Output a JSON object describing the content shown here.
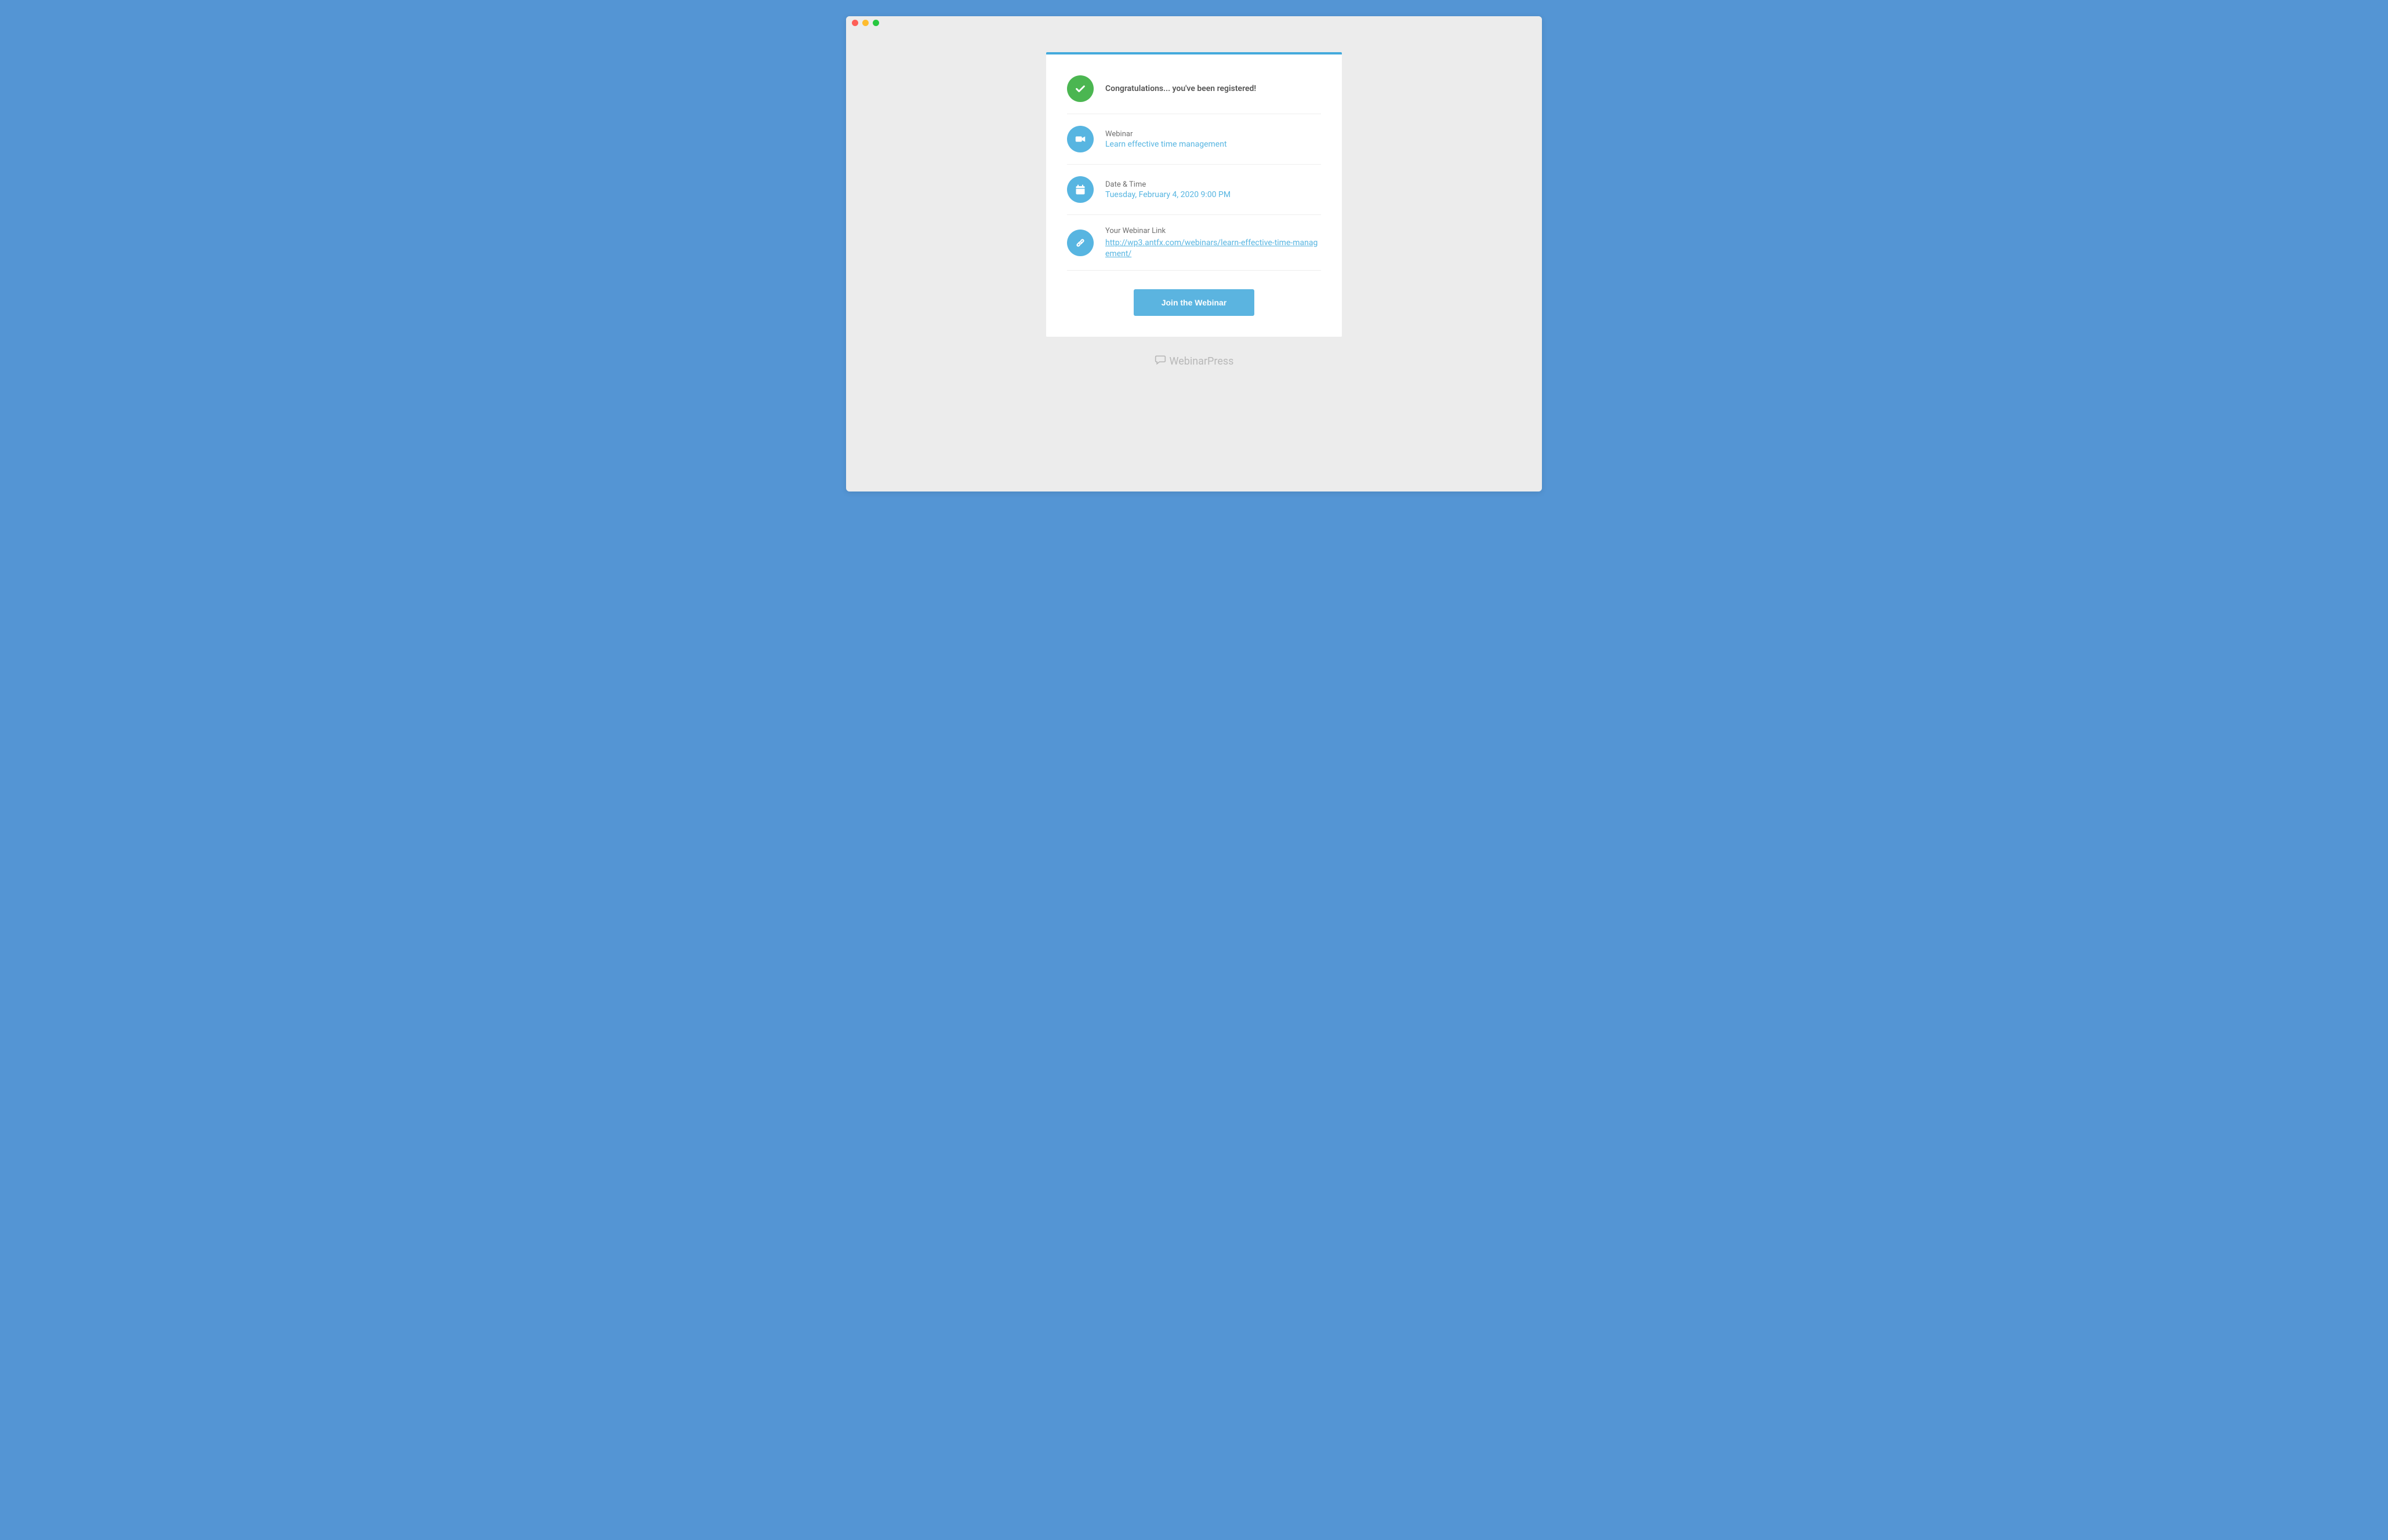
{
  "headline": "Congratulations... you've been registered!",
  "webinar": {
    "label": "Webinar",
    "value": "Learn effective time management"
  },
  "datetime": {
    "label": "Date & Time",
    "value": "Tuesday, February 4, 2020 9:00 PM"
  },
  "link": {
    "label": "Your Webinar Link",
    "value": "http://wp3.antfx.com/webinars/learn-effective-time-management/"
  },
  "join_button": "Join the Webinar",
  "brand": "WebinarPress"
}
